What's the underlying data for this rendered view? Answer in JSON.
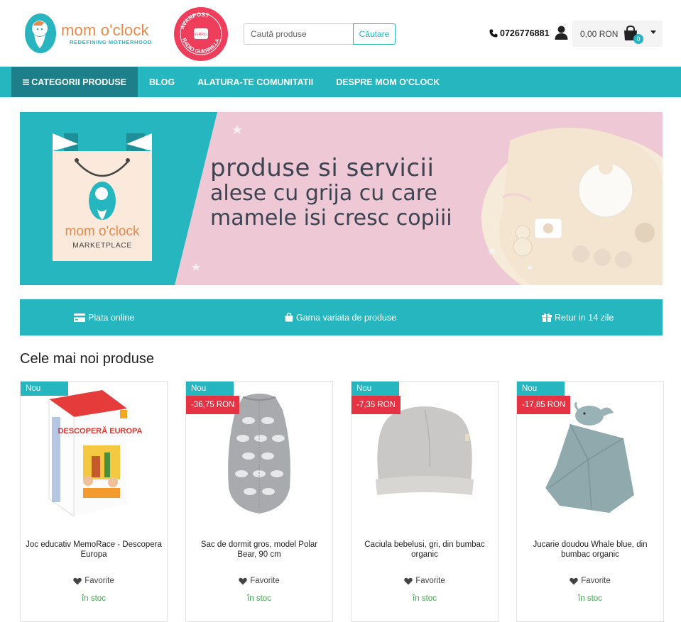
{
  "header": {
    "logo": {
      "name": "mom o'clock",
      "tagline": "REDEFINING MOTHERHOOD"
    },
    "badge": {
      "top_text": "AVANPOST",
      "bottom_text": "RADIO GUERRILLA",
      "center_text": "GUERRILLA"
    },
    "search": {
      "placeholder": "Caută produse",
      "button": "Căutare"
    },
    "phone": "0726776881",
    "cart": {
      "total": "0,00 RON",
      "count": "0"
    }
  },
  "nav": {
    "items": [
      {
        "label": "CATEGORII PRODUSE"
      },
      {
        "label": "BLOG"
      },
      {
        "label": "ALATURA-TE COMUNITATII"
      },
      {
        "label": "DESPRE MOM O'CLOCK"
      }
    ]
  },
  "banner": {
    "lines": [
      "produse si servicii",
      "alese cu grija cu care",
      "mamele isi cresc copiii"
    ],
    "brand": "mom o'clock",
    "brand_sub": "MARKETPLACE",
    "colors": {
      "teal": "#25b6bf",
      "pink": "#efc8d6"
    }
  },
  "features": [
    {
      "icon": "credit-card-icon",
      "label": "Plata online"
    },
    {
      "icon": "shopping-bag-icon",
      "label": "Gama variata de produse"
    },
    {
      "icon": "gift-icon",
      "label": "Retur in 14 zile"
    }
  ],
  "section": {
    "title": "Cele mai noi produse"
  },
  "products": [
    {
      "name": "Joc educativ MemoRace - Descopera Europa",
      "badge": "Nou",
      "discount": "",
      "favorite": "Favorite",
      "stock": "în stoc",
      "box_title": "DESCOPERĂ EUROPA"
    },
    {
      "name": "Sac de dormit gros, model Polar Bear, 90 cm",
      "badge": "Nou",
      "discount": "-36,75 RON",
      "favorite": "Favorite",
      "stock": "în stoc"
    },
    {
      "name": "Caciula bebelusi, gri, din bumbac organic",
      "badge": "Nou",
      "discount": "-7,35 RON",
      "favorite": "Favorite",
      "stock": "în stoc"
    },
    {
      "name": "Jucarie doudou Whale blue, din bumbac organic",
      "badge": "Nou",
      "discount": "-17,85 RON",
      "favorite": "Favorite",
      "stock": "în stoc"
    }
  ]
}
